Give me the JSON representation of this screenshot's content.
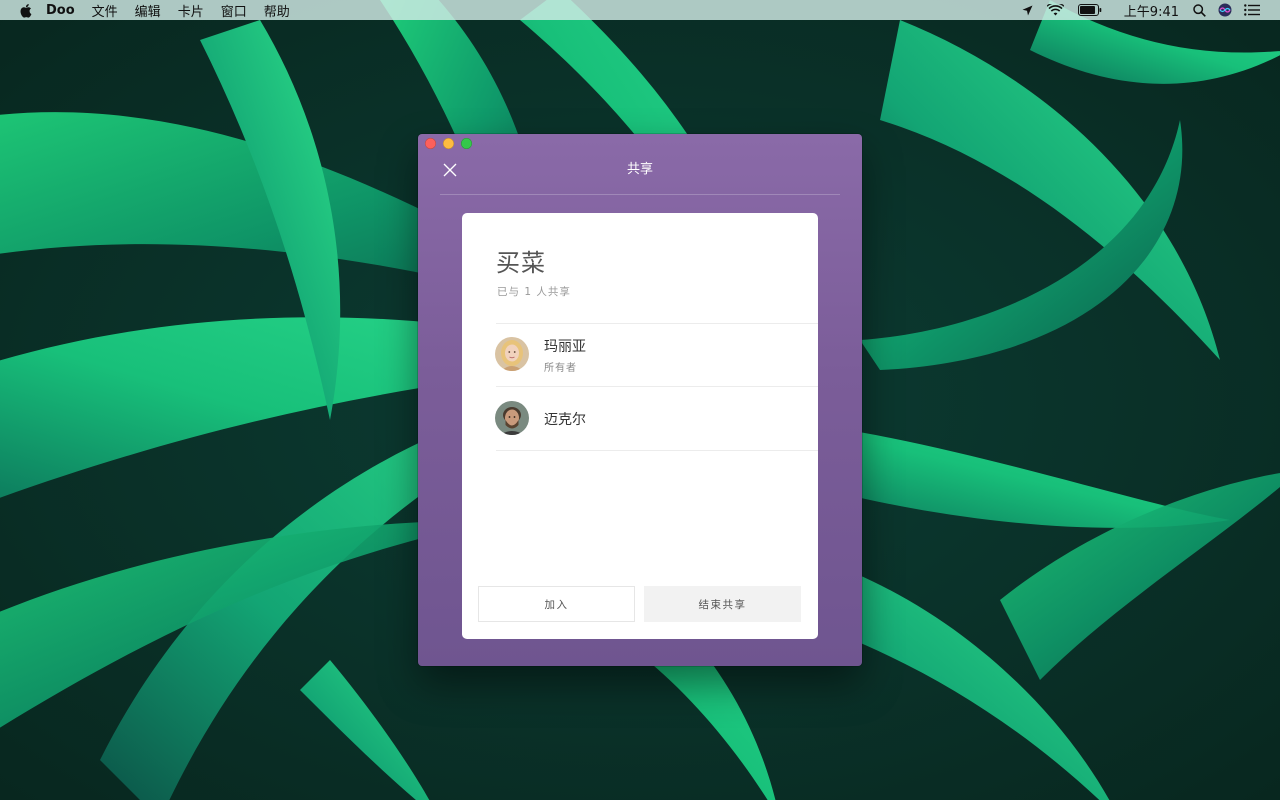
{
  "menubar": {
    "app_name": "Doo",
    "items": [
      "文件",
      "编辑",
      "卡片",
      "窗口",
      "帮助"
    ],
    "clock": "上午9:41"
  },
  "window": {
    "title": "共享"
  },
  "card": {
    "list_title": "买菜",
    "share_status": "已与 1 人共享",
    "members": [
      {
        "name": "玛丽亚",
        "role": "所有者"
      },
      {
        "name": "迈克尔",
        "role": ""
      }
    ],
    "join_button": "加入",
    "end_share_button": "结束共享"
  },
  "colors": {
    "window_accent": "#7b5d99",
    "card_background": "#ffffff",
    "traffic_close": "#fc605c",
    "traffic_minimize": "#fdbc40",
    "traffic_zoom": "#34c84a"
  },
  "icons": {
    "apple": "apple-logo-icon",
    "location": "location-arrow-icon",
    "wifi": "wifi-icon",
    "battery": "battery-icon",
    "search": "spotlight-search-icon",
    "siri": "siri-icon",
    "notifications": "notification-center-icon",
    "close": "close-icon"
  }
}
